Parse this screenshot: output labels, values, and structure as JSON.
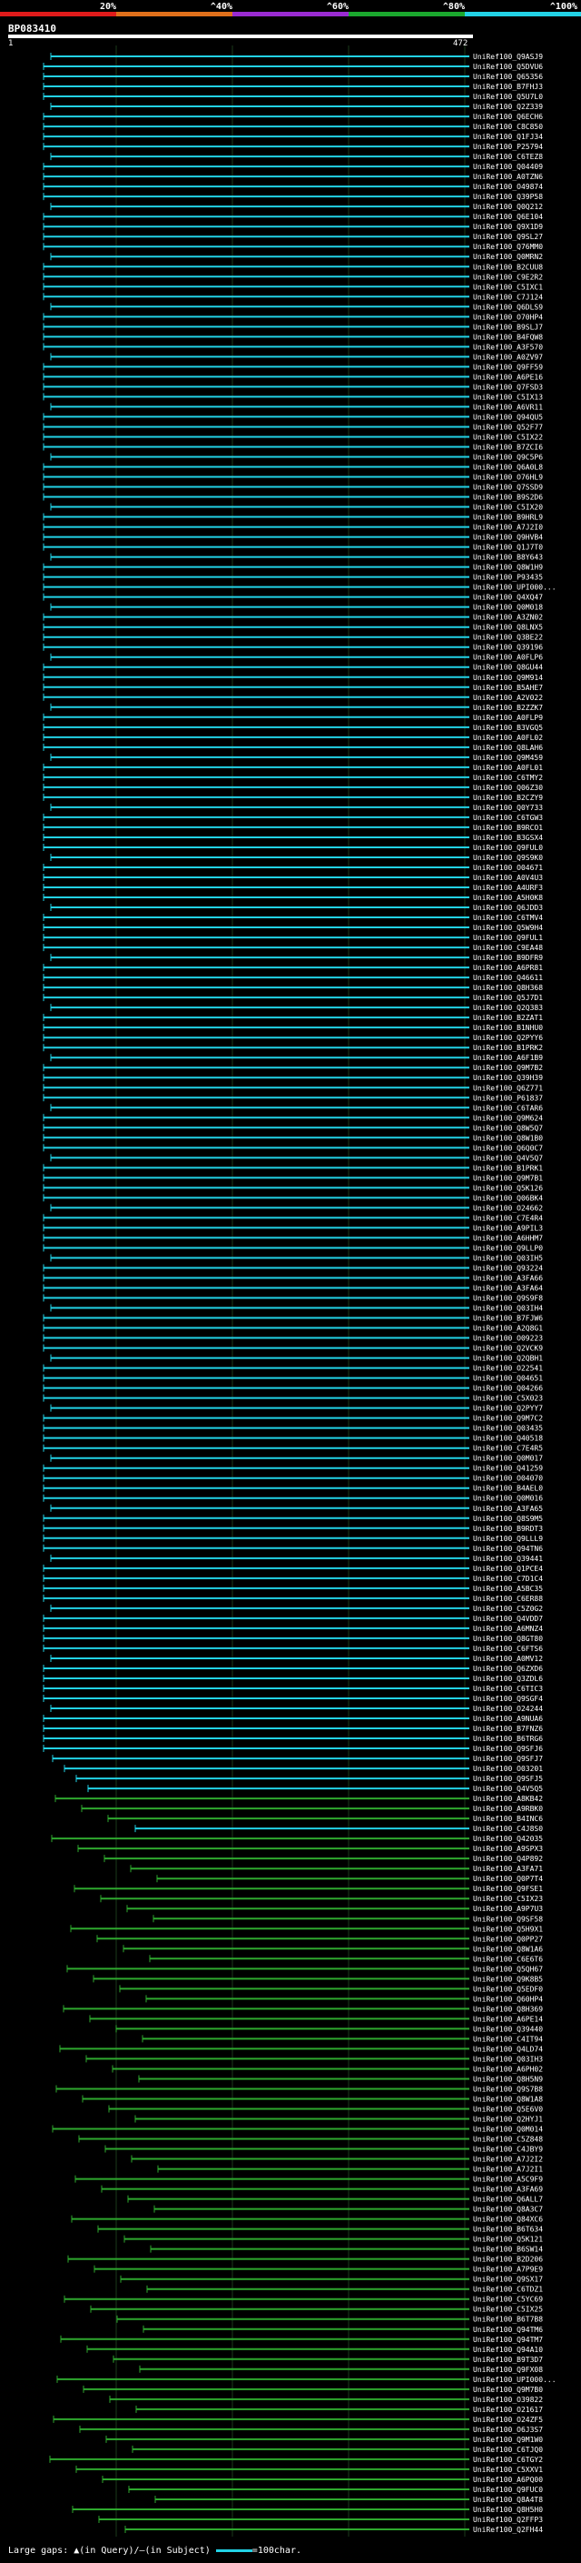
{
  "page": {
    "query_id": "BP083410",
    "range_start": "1",
    "range_end": "472"
  },
  "scale": {
    "labels": [
      "20%",
      "^40%",
      "^60%",
      "^80%",
      "^100%"
    ],
    "colors": [
      "#e01b1b",
      "#e0701b",
      "#9a2bd1",
      "#1ba82e",
      "#22d2e6"
    ]
  },
  "hit_colors": {
    "high": "#22d2e6",
    "mid": "#2ea82e"
  },
  "hits": [
    {
      "label": "UniRef100_Q9ASJ9",
      "identity": "high"
    },
    {
      "label": "UniRef100_Q5DVU6",
      "identity": "high"
    },
    {
      "label": "UniRef100_Q65356",
      "identity": "high"
    },
    {
      "label": "UniRef100_B7FHJ3",
      "identity": "high"
    },
    {
      "label": "UniRef100_Q5U7L0",
      "identity": "high"
    },
    {
      "label": "UniRef100_Q2Z339",
      "identity": "high"
    },
    {
      "label": "UniRef100_Q6ECH6",
      "identity": "high"
    },
    {
      "label": "UniRef100_C8C850",
      "identity": "high"
    },
    {
      "label": "UniRef100_Q1FJ34",
      "identity": "high"
    },
    {
      "label": "UniRef100_P25794",
      "identity": "high"
    },
    {
      "label": "UniRef100_C6TEZ8",
      "identity": "high"
    },
    {
      "label": "UniRef100_Q04409",
      "identity": "high"
    },
    {
      "label": "UniRef100_A0TZN6",
      "identity": "high"
    },
    {
      "label": "UniRef100_O49874",
      "identity": "high"
    },
    {
      "label": "UniRef100_Q39P58",
      "identity": "high"
    },
    {
      "label": "UniRef100_Q0Q212",
      "identity": "high"
    },
    {
      "label": "UniRef100_Q6E104",
      "identity": "high"
    },
    {
      "label": "UniRef100_Q9X1D9",
      "identity": "high"
    },
    {
      "label": "UniRef100_Q9SL27",
      "identity": "high"
    },
    {
      "label": "UniRef100_Q76MM0",
      "identity": "high"
    },
    {
      "label": "UniRef100_Q0MRN2",
      "identity": "high"
    },
    {
      "label": "UniRef100_B2CUU8",
      "identity": "high"
    },
    {
      "label": "UniRef100_C9E2R2",
      "identity": "high"
    },
    {
      "label": "UniRef100_C5IXC1",
      "identity": "high"
    },
    {
      "label": "UniRef100_C7J124",
      "identity": "high"
    },
    {
      "label": "UniRef100_Q6DLS9",
      "identity": "high"
    },
    {
      "label": "UniRef100_O70HP4",
      "identity": "high"
    },
    {
      "label": "UniRef100_B9SLJ7",
      "identity": "high"
    },
    {
      "label": "UniRef100_B4FQW8",
      "identity": "high"
    },
    {
      "label": "UniRef100_A3F570",
      "identity": "high"
    },
    {
      "label": "UniRef100_A0ZV97",
      "identity": "high"
    },
    {
      "label": "UniRef100_Q9FF59",
      "identity": "high"
    },
    {
      "label": "UniRef100_A6PE16",
      "identity": "high"
    },
    {
      "label": "UniRef100_Q7FSD3",
      "identity": "high"
    },
    {
      "label": "UniRef100_C5IX13",
      "identity": "high"
    },
    {
      "label": "UniRef100_A6VR11",
      "identity": "high"
    },
    {
      "label": "UniRef100_Q94QU5",
      "identity": "high"
    },
    {
      "label": "UniRef100_Q52F77",
      "identity": "high"
    },
    {
      "label": "UniRef100_C5IX22",
      "identity": "high"
    },
    {
      "label": "UniRef100_B7ZCI6",
      "identity": "high"
    },
    {
      "label": "UniRef100_Q9C5P6",
      "identity": "high"
    },
    {
      "label": "UniRef100_Q6A0L8",
      "identity": "high"
    },
    {
      "label": "UniRef100_O76HL9",
      "identity": "high"
    },
    {
      "label": "UniRef100_Q7SSD9",
      "identity": "high"
    },
    {
      "label": "UniRef100_B9S2D6",
      "identity": "high"
    },
    {
      "label": "UniRef100_C5IX20",
      "identity": "high"
    },
    {
      "label": "UniRef100_B9HRL9",
      "identity": "high"
    },
    {
      "label": "UniRef100_A7J2I0",
      "identity": "high"
    },
    {
      "label": "UniRef100_Q9HVB4",
      "identity": "high"
    },
    {
      "label": "UniRef100_Q1J7T0",
      "identity": "high"
    },
    {
      "label": "UniRef100_B8Y643",
      "identity": "high"
    },
    {
      "label": "UniRef100_Q8W1H9",
      "identity": "high"
    },
    {
      "label": "UniRef100_P93435",
      "identity": "high"
    },
    {
      "label": "UniRef100_UPI000...",
      "identity": "high"
    },
    {
      "label": "UniRef100_Q4XQ47",
      "identity": "high"
    },
    {
      "label": "UniRef100_Q0M018",
      "identity": "high"
    },
    {
      "label": "UniRef100_A3ZN02",
      "identity": "high"
    },
    {
      "label": "UniRef100_Q8LNX5",
      "identity": "high"
    },
    {
      "label": "UniRef100_Q3BE22",
      "identity": "high"
    },
    {
      "label": "UniRef100_Q39196",
      "identity": "high"
    },
    {
      "label": "UniRef100_A0FLP6",
      "identity": "high"
    },
    {
      "label": "UniRef100_Q8GU44",
      "identity": "high"
    },
    {
      "label": "UniRef100_Q9M914",
      "identity": "high"
    },
    {
      "label": "UniRef100_B5AHE7",
      "identity": "high"
    },
    {
      "label": "UniRef100_A2V022",
      "identity": "high"
    },
    {
      "label": "UniRef100_B2ZZK7",
      "identity": "high"
    },
    {
      "label": "UniRef100_A0FLP9",
      "identity": "high"
    },
    {
      "label": "UniRef100_B3VGQ5",
      "identity": "high"
    },
    {
      "label": "UniRef100_A0FL02",
      "identity": "high"
    },
    {
      "label": "UniRef100_Q8LAH6",
      "identity": "high"
    },
    {
      "label": "UniRef100_Q9M459",
      "identity": "high"
    },
    {
      "label": "UniRef100_A0FL01",
      "identity": "high"
    },
    {
      "label": "UniRef100_C6TMY2",
      "identity": "high"
    },
    {
      "label": "UniRef100_Q06Z30",
      "identity": "high"
    },
    {
      "label": "UniRef100_B2CZY9",
      "identity": "high"
    },
    {
      "label": "UniRef100_Q0Y733",
      "identity": "high"
    },
    {
      "label": "UniRef100_C6TGW3",
      "identity": "high"
    },
    {
      "label": "UniRef100_B9RCO1",
      "identity": "high"
    },
    {
      "label": "UniRef100_B3GSX4",
      "identity": "high"
    },
    {
      "label": "UniRef100_Q9FUL0",
      "identity": "high"
    },
    {
      "label": "UniRef100_Q9S9K0",
      "identity": "high"
    },
    {
      "label": "UniRef100_O04671",
      "identity": "high"
    },
    {
      "label": "UniRef100_A0V4U3",
      "identity": "high"
    },
    {
      "label": "UniRef100_A4URF3",
      "identity": "high"
    },
    {
      "label": "UniRef100_A5H0K8",
      "identity": "high"
    },
    {
      "label": "UniRef100_Q6JDD3",
      "identity": "high"
    },
    {
      "label": "UniRef100_C6TMV4",
      "identity": "high"
    },
    {
      "label": "UniRef100_Q5W9H4",
      "identity": "high"
    },
    {
      "label": "UniRef100_Q9FUL1",
      "identity": "high"
    },
    {
      "label": "UniRef100_C9EA48",
      "identity": "high"
    },
    {
      "label": "UniRef100_B9DFR9",
      "identity": "high"
    },
    {
      "label": "UniRef100_A6PR81",
      "identity": "high"
    },
    {
      "label": "UniRef100_Q46611",
      "identity": "high"
    },
    {
      "label": "UniRef100_Q8H368",
      "identity": "high"
    },
    {
      "label": "UniRef100_Q5J7D1",
      "identity": "high"
    },
    {
      "label": "UniRef100_Q2Q383",
      "identity": "high"
    },
    {
      "label": "UniRef100_B2ZAT1",
      "identity": "high"
    },
    {
      "label": "UniRef100_B1NHU0",
      "identity": "high"
    },
    {
      "label": "UniRef100_Q2PYY6",
      "identity": "high"
    },
    {
      "label": "UniRef100_B1PRK2",
      "identity": "high"
    },
    {
      "label": "UniRef100_A6F1B9",
      "identity": "high"
    },
    {
      "label": "UniRef100_Q9M7B2",
      "identity": "high"
    },
    {
      "label": "UniRef100_Q39H39",
      "identity": "high"
    },
    {
      "label": "UniRef100_Q6Z771",
      "identity": "high"
    },
    {
      "label": "UniRef100_P61837",
      "identity": "high"
    },
    {
      "label": "UniRef100_C6TAR6",
      "identity": "high"
    },
    {
      "label": "UniRef100_Q9M624",
      "identity": "high"
    },
    {
      "label": "UniRef100_Q8W5Q7",
      "identity": "high"
    },
    {
      "label": "UniRef100_Q8W1B0",
      "identity": "high"
    },
    {
      "label": "UniRef100_Q6Q0C7",
      "identity": "high"
    },
    {
      "label": "UniRef100_Q4V5Q7",
      "identity": "high"
    },
    {
      "label": "UniRef100_B1PRK1",
      "identity": "high"
    },
    {
      "label": "UniRef100_Q9M7B1",
      "identity": "high"
    },
    {
      "label": "UniRef100_Q5K126",
      "identity": "high"
    },
    {
      "label": "UniRef100_Q06BK4",
      "identity": "high"
    },
    {
      "label": "UniRef100_O24662",
      "identity": "high"
    },
    {
      "label": "UniRef100_C7E4R4",
      "identity": "high"
    },
    {
      "label": "UniRef100_A9PIL3",
      "identity": "high"
    },
    {
      "label": "UniRef100_A6HHM7",
      "identity": "high"
    },
    {
      "label": "UniRef100_Q9LLP0",
      "identity": "high"
    },
    {
      "label": "UniRef100_Q03IH5",
      "identity": "high"
    },
    {
      "label": "UniRef100_Q93224",
      "identity": "high"
    },
    {
      "label": "UniRef100_A3FA66",
      "identity": "high"
    },
    {
      "label": "UniRef100_A3FA64",
      "identity": "high"
    },
    {
      "label": "UniRef100_Q9S9F8",
      "identity": "high"
    },
    {
      "label": "UniRef100_Q03IH4",
      "identity": "high"
    },
    {
      "label": "UniRef100_B7FJW6",
      "identity": "high"
    },
    {
      "label": "UniRef100_A2Q8G1",
      "identity": "high"
    },
    {
      "label": "UniRef100_O09223",
      "identity": "high"
    },
    {
      "label": "UniRef100_Q2VCK9",
      "identity": "high"
    },
    {
      "label": "UniRef100_Q2QBH1",
      "identity": "high"
    },
    {
      "label": "UniRef100_O22541",
      "identity": "high"
    },
    {
      "label": "UniRef100_Q04651",
      "identity": "high"
    },
    {
      "label": "UniRef100_Q04266",
      "identity": "high"
    },
    {
      "label": "UniRef100_C5X023",
      "identity": "high"
    },
    {
      "label": "UniRef100_Q2PYY7",
      "identity": "high"
    },
    {
      "label": "UniRef100_Q9M7C2",
      "identity": "high"
    },
    {
      "label": "UniRef100_Q03435",
      "identity": "high"
    },
    {
      "label": "UniRef100_Q40518",
      "identity": "high"
    },
    {
      "label": "UniRef100_C7E4R5",
      "identity": "high"
    },
    {
      "label": "UniRef100_Q0M017",
      "identity": "high"
    },
    {
      "label": "UniRef100_Q41259",
      "identity": "high"
    },
    {
      "label": "UniRef100_O04070",
      "identity": "high"
    },
    {
      "label": "UniRef100_B4AEL0",
      "identity": "high"
    },
    {
      "label": "UniRef100_Q0M016",
      "identity": "high"
    },
    {
      "label": "UniRef100_A3FA65",
      "identity": "high"
    },
    {
      "label": "UniRef100_Q8S9M5",
      "identity": "high"
    },
    {
      "label": "UniRef100_B9RDT3",
      "identity": "high"
    },
    {
      "label": "UniRef100_Q9LLL9",
      "identity": "high"
    },
    {
      "label": "UniRef100_Q94TN6",
      "identity": "high"
    },
    {
      "label": "UniRef100_Q39441",
      "identity": "high"
    },
    {
      "label": "UniRef100_Q1PCE4",
      "identity": "high"
    },
    {
      "label": "UniRef100_C7D1C4",
      "identity": "high"
    },
    {
      "label": "UniRef100_A5BC35",
      "identity": "high"
    },
    {
      "label": "UniRef100_C6ER88",
      "identity": "high"
    },
    {
      "label": "UniRef100_C5Z0G2",
      "identity": "high"
    },
    {
      "label": "UniRef100_Q4VDD7",
      "identity": "high"
    },
    {
      "label": "UniRef100_A6MNZ4",
      "identity": "high"
    },
    {
      "label": "UniRef100_Q8GT80",
      "identity": "high"
    },
    {
      "label": "UniRef100_C6FTS6",
      "identity": "high"
    },
    {
      "label": "UniRef100_A0MV12",
      "identity": "high"
    },
    {
      "label": "UniRef100_Q6ZXD6",
      "identity": "high"
    },
    {
      "label": "UniRef100_Q3ZDL6",
      "identity": "high"
    },
    {
      "label": "UniRef100_C6TIC3",
      "identity": "high"
    },
    {
      "label": "UniRef100_Q9SGF4",
      "identity": "high"
    },
    {
      "label": "UniRef100_O24244",
      "identity": "high"
    },
    {
      "label": "UniRef100_A9NUA6",
      "identity": "high"
    },
    {
      "label": "UniRef100_B7FNZ6",
      "identity": "high"
    },
    {
      "label": "UniRef100_B6TRG6",
      "identity": "high"
    },
    {
      "label": "UniRef100_Q9SFJ6",
      "identity": "high"
    },
    {
      "label": "UniRef100_Q9SFJ7",
      "identity": "high"
    },
    {
      "label": "UniRef100_O03201",
      "identity": "high"
    },
    {
      "label": "UniRef100_Q9SFJ5",
      "identity": "high"
    },
    {
      "label": "UniRef100_Q4V5Q5",
      "identity": "high"
    },
    {
      "label": "UniRef100_A8KB42",
      "identity": "mid"
    },
    {
      "label": "UniRef100_A9RBK0",
      "identity": "mid"
    },
    {
      "label": "UniRef100_B4INC6",
      "identity": "mid"
    },
    {
      "label": "UniRef100_C4J8S0",
      "identity": "high"
    },
    {
      "label": "UniRef100_Q42035",
      "identity": "mid"
    },
    {
      "label": "UniRef100_A9SPX3",
      "identity": "mid"
    },
    {
      "label": "UniRef100_Q4P892",
      "identity": "mid"
    },
    {
      "label": "UniRef100_A3FA71",
      "identity": "mid"
    },
    {
      "label": "UniRef100_Q0P7T4",
      "identity": "mid"
    },
    {
      "label": "UniRef100_Q9FSE1",
      "identity": "mid"
    },
    {
      "label": "UniRef100_C5IX23",
      "identity": "mid"
    },
    {
      "label": "UniRef100_A9P7U3",
      "identity": "mid"
    },
    {
      "label": "UniRef100_Q9SF58",
      "identity": "mid"
    },
    {
      "label": "UniRef100_Q5H9X1",
      "identity": "mid"
    },
    {
      "label": "UniRef100_Q0PP27",
      "identity": "mid"
    },
    {
      "label": "UniRef100_Q8W1A6",
      "identity": "mid"
    },
    {
      "label": "UniRef100_C6E6T6",
      "identity": "mid"
    },
    {
      "label": "UniRef100_Q5QH67",
      "identity": "mid"
    },
    {
      "label": "UniRef100_Q9K8B5",
      "identity": "mid"
    },
    {
      "label": "UniRef100_Q5EDF0",
      "identity": "mid"
    },
    {
      "label": "UniRef100_Q60HP4",
      "identity": "mid"
    },
    {
      "label": "UniRef100_Q8H369",
      "identity": "mid"
    },
    {
      "label": "UniRef100_A6PE14",
      "identity": "mid"
    },
    {
      "label": "UniRef100_Q39440",
      "identity": "mid"
    },
    {
      "label": "UniRef100_C4IT94",
      "identity": "mid"
    },
    {
      "label": "UniRef100_Q4LD74",
      "identity": "mid"
    },
    {
      "label": "UniRef100_Q03IH3",
      "identity": "mid"
    },
    {
      "label": "UniRef100_A6PH02",
      "identity": "mid"
    },
    {
      "label": "UniRef100_Q8H5N9",
      "identity": "mid"
    },
    {
      "label": "UniRef100_Q9S7B8",
      "identity": "mid"
    },
    {
      "label": "UniRef100_Q8W1A8",
      "identity": "mid"
    },
    {
      "label": "UniRef100_Q5E6V0",
      "identity": "mid"
    },
    {
      "label": "UniRef100_Q2HYJ1",
      "identity": "mid"
    },
    {
      "label": "UniRef100_Q0M014",
      "identity": "mid"
    },
    {
      "label": "UniRef100_C5Z848",
      "identity": "mid"
    },
    {
      "label": "UniRef100_C4JBY9",
      "identity": "mid"
    },
    {
      "label": "UniRef100_A7J2I2",
      "identity": "mid"
    },
    {
      "label": "UniRef100_A7J2I1",
      "identity": "mid"
    },
    {
      "label": "UniRef100_A5C9F9",
      "identity": "mid"
    },
    {
      "label": "UniRef100_A3FA69",
      "identity": "mid"
    },
    {
      "label": "UniRef100_Q6ALL7",
      "identity": "mid"
    },
    {
      "label": "UniRef100_Q8A3C7",
      "identity": "mid"
    },
    {
      "label": "UniRef100_Q84XC6",
      "identity": "mid"
    },
    {
      "label": "UniRef100_B6T634",
      "identity": "mid"
    },
    {
      "label": "UniRef100_Q5K121",
      "identity": "mid"
    },
    {
      "label": "UniRef100_B6SW14",
      "identity": "mid"
    },
    {
      "label": "UniRef100_B2D206",
      "identity": "mid"
    },
    {
      "label": "UniRef100_A7P9E9",
      "identity": "mid"
    },
    {
      "label": "UniRef100_Q9SX17",
      "identity": "mid"
    },
    {
      "label": "UniRef100_C6TDZ1",
      "identity": "mid"
    },
    {
      "label": "UniRef100_C5YC69",
      "identity": "mid"
    },
    {
      "label": "UniRef100_C5IX25",
      "identity": "mid"
    },
    {
      "label": "UniRef100_B6T7B8",
      "identity": "mid"
    },
    {
      "label": "UniRef100_Q94TM6",
      "identity": "mid"
    },
    {
      "label": "UniRef100_Q94TM7",
      "identity": "mid"
    },
    {
      "label": "UniRef100_Q94A10",
      "identity": "mid"
    },
    {
      "label": "UniRef100_B9T3D7",
      "identity": "mid"
    },
    {
      "label": "UniRef100_Q9FX08",
      "identity": "mid"
    },
    {
      "label": "UniRef100_UPI000...",
      "identity": "mid"
    },
    {
      "label": "UniRef100_Q9M7B0",
      "identity": "mid"
    },
    {
      "label": "UniRef100_O39822",
      "identity": "mid"
    },
    {
      "label": "UniRef100_O21617",
      "identity": "mid"
    },
    {
      "label": "UniRef100_O24ZF5",
      "identity": "mid"
    },
    {
      "label": "UniRef100_O6J3S7",
      "identity": "mid"
    },
    {
      "label": "UniRef100_Q9M1W0",
      "identity": "mid"
    },
    {
      "label": "UniRef100_C6TJQ0",
      "identity": "mid"
    },
    {
      "label": "UniRef100_C6TGY2",
      "identity": "mid"
    },
    {
      "label": "UniRef100_C5XXV1",
      "identity": "mid"
    },
    {
      "label": "UniRef100_A6PQ00",
      "identity": "mid"
    },
    {
      "label": "UniRef100_Q9FUC0",
      "identity": "mid"
    },
    {
      "label": "UniRef100_Q8A4T8",
      "identity": "mid"
    },
    {
      "label": "UniRef100_Q8H5H0",
      "identity": "mid"
    },
    {
      "label": "UniRef100_Q2FFP3",
      "identity": "mid"
    },
    {
      "label": "UniRef100_Q2FH44",
      "identity": "mid"
    }
  ],
  "footer": {
    "text_prefix": "Large gaps: ",
    "gap_query": "▲",
    "gap_query_label": "(in Query)/",
    "gap_subject": "—",
    "gap_subject_label": "(in Subject)",
    "scale_legend": "=100char."
  }
}
